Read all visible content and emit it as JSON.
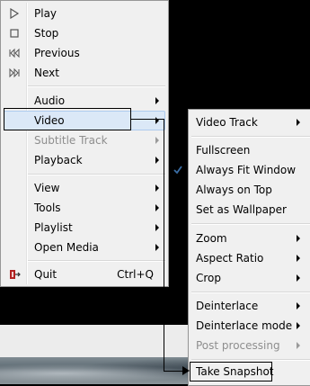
{
  "main_menu": {
    "items": [
      {
        "label": "Play",
        "icon": "play-icon"
      },
      {
        "label": "Stop",
        "icon": "stop-icon"
      },
      {
        "label": "Previous",
        "icon": "previous-icon"
      },
      {
        "label": "Next",
        "icon": "next-icon"
      },
      {
        "label": "Audio"
      },
      {
        "label": "Video"
      },
      {
        "label": "Subtitle Track"
      },
      {
        "label": "Playback"
      },
      {
        "label": "View"
      },
      {
        "label": "Tools"
      },
      {
        "label": "Playlist"
      },
      {
        "label": "Open Media"
      },
      {
        "label": "Quit",
        "shortcut": "Ctrl+Q",
        "icon": "quit-icon"
      }
    ]
  },
  "video_menu": {
    "items": [
      {
        "label": "Video Track"
      },
      {
        "label": "Fullscreen"
      },
      {
        "label": "Always Fit Window",
        "checked": true
      },
      {
        "label": "Always on Top"
      },
      {
        "label": "Set as Wallpaper"
      },
      {
        "label": "Zoom"
      },
      {
        "label": "Aspect Ratio"
      },
      {
        "label": "Crop"
      },
      {
        "label": "Deinterlace"
      },
      {
        "label": "Deinterlace mode"
      },
      {
        "label": "Post processing"
      },
      {
        "label": "Take Snapshot"
      }
    ]
  },
  "colors": {
    "menu_bg": "#f0f0f0",
    "highlight": "#dbe8f7",
    "disabled_text": "#8e8e8e",
    "check": "#3b6ea5"
  }
}
